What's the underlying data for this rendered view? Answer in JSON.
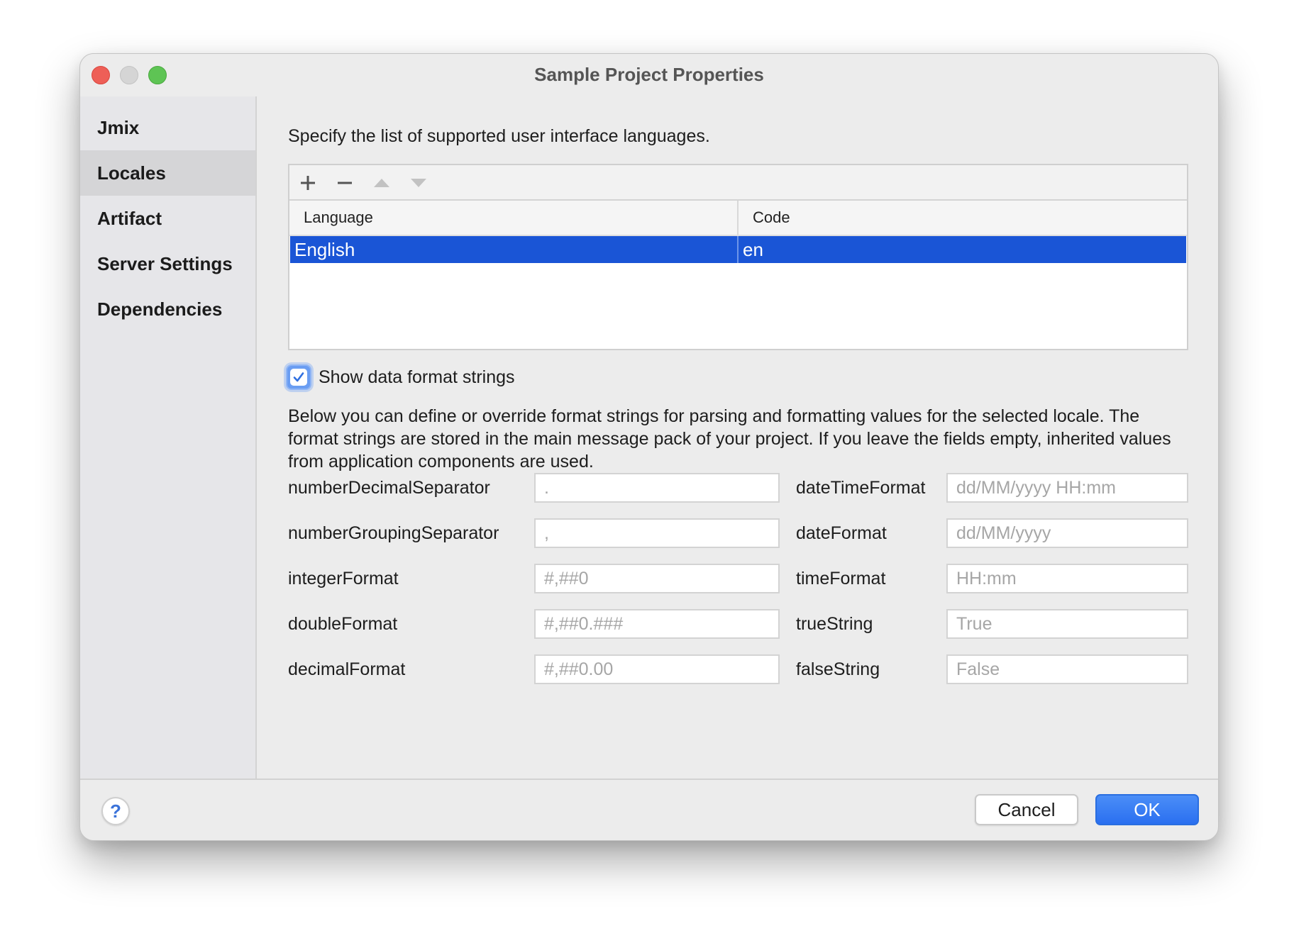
{
  "window": {
    "title": "Sample Project Properties"
  },
  "sidebar": {
    "items": [
      {
        "label": "Jmix",
        "selected": false
      },
      {
        "label": "Locales",
        "selected": true
      },
      {
        "label": "Artifact",
        "selected": false
      },
      {
        "label": "Server Settings",
        "selected": false
      },
      {
        "label": "Dependencies",
        "selected": false
      }
    ]
  },
  "main": {
    "intro": "Specify the list of supported user interface languages.",
    "toolbar_icons": [
      "add-icon",
      "remove-icon",
      "move-up-icon",
      "move-down-icon"
    ],
    "table": {
      "columns": [
        "Language",
        "Code"
      ],
      "rows": [
        {
          "language": "English",
          "code": "en",
          "selected": true
        }
      ]
    },
    "show_format_checkbox": {
      "label": "Show data format strings",
      "checked": true
    },
    "description": "Below you can define or override format strings for parsing and formatting values for the selected locale. The format strings are stored in the main message pack of your project. If you leave the fields empty, inherited values from application components are used.",
    "left_fields": [
      {
        "label": "numberDecimalSeparator",
        "placeholder": "."
      },
      {
        "label": "numberGroupingSeparator",
        "placeholder": ","
      },
      {
        "label": "integerFormat",
        "placeholder": "#,##0"
      },
      {
        "label": "doubleFormat",
        "placeholder": "#,##0.###"
      },
      {
        "label": "decimalFormat",
        "placeholder": "#,##0.00"
      }
    ],
    "right_fields": [
      {
        "label": "dateTimeFormat",
        "placeholder": "dd/MM/yyyy HH:mm"
      },
      {
        "label": "dateFormat",
        "placeholder": "dd/MM/yyyy"
      },
      {
        "label": "timeFormat",
        "placeholder": "HH:mm"
      },
      {
        "label": "trueString",
        "placeholder": "True"
      },
      {
        "label": "falseString",
        "placeholder": "False"
      }
    ]
  },
  "footer": {
    "help_label": "?",
    "cancel_label": "Cancel",
    "ok_label": "OK"
  },
  "colors": {
    "selection": "#1a55d6",
    "accent": "#2f7af5",
    "close": "#ee5f57",
    "maximize": "#5ec454"
  }
}
